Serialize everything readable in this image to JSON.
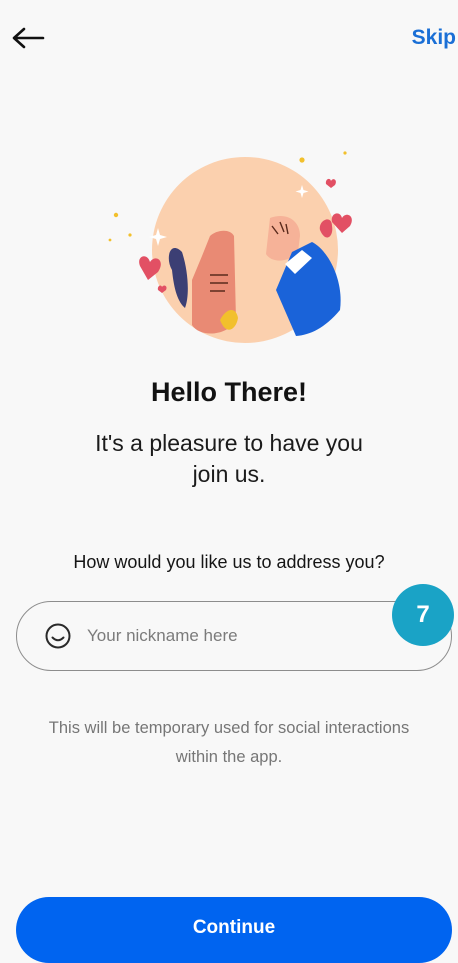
{
  "nav": {
    "back_icon": "arrow-left-icon",
    "skip_label": "Skip"
  },
  "illustration": {
    "name": "fist-bump-illustration"
  },
  "heading": {
    "title": "Hello There!",
    "subtitle_line1": "It's a pleasure to have you",
    "subtitle_line2": "join us."
  },
  "form": {
    "question": "How would you like us to address you?",
    "nickname": {
      "value": "",
      "placeholder": "Your nickname here",
      "icon": "smiley-icon"
    },
    "helper_line1": "This will be temporary used for social interactions",
    "helper_line2": "within the app."
  },
  "badge": {
    "text": "7",
    "color": "#1aa3c6"
  },
  "actions": {
    "continue_label": "Continue"
  },
  "colors": {
    "primary": "#0064f0",
    "link": "#1a6fd6"
  }
}
